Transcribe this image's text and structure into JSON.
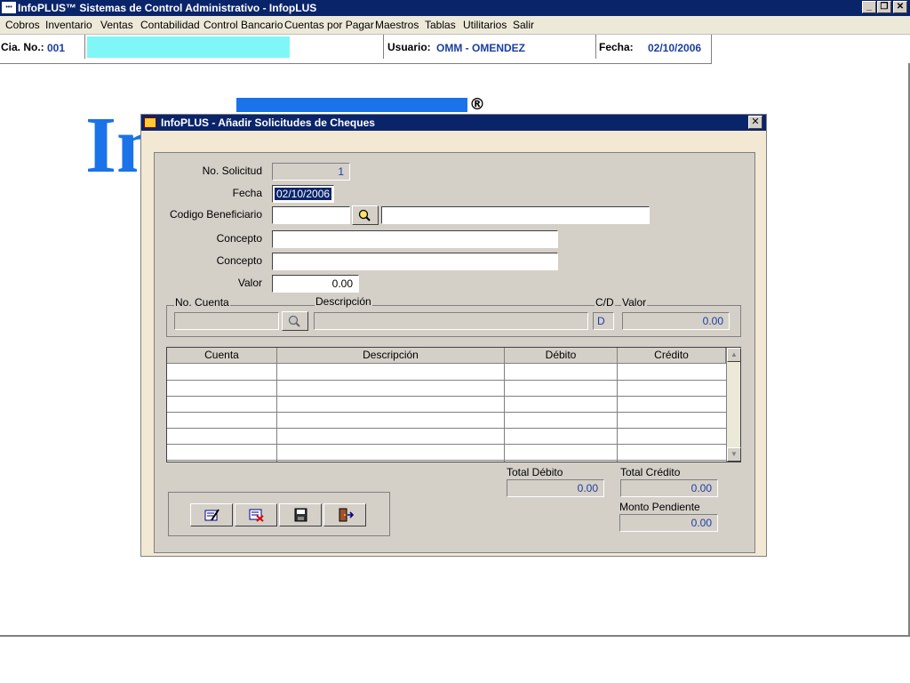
{
  "window": {
    "title": "InfoPLUS™ Sistemas de Control Administrativo - InfopLUS",
    "icon": "infoplus-app-icon"
  },
  "menu": [
    "Cobros",
    "Inventario",
    "Ventas",
    "Contabilidad",
    "Control Bancario",
    "Cuentas por Pagar",
    "Maestros",
    "Tablas",
    "Utilitarios",
    "Salir"
  ],
  "infobar": {
    "cia_label": "Cia. No.:",
    "cia_value": "001",
    "usuario_label": "Usuario:",
    "usuario_value": "OMM - OMENDEZ",
    "fecha_label": "Fecha:",
    "fecha_value": "02/10/2006"
  },
  "background": {
    "logo_text": "In",
    "registered": "®"
  },
  "dialog": {
    "title": "InfoPLUS - Añadir Solicitudes de Cheques",
    "no_solicitud_label": "No. Solicitud",
    "no_solicitud_value": "1",
    "fecha_label": "Fecha",
    "fecha_value": "02/10/2006",
    "codigo_label": "Codigo Beneficiario",
    "codigo_value": "",
    "beneficiario_nombre": "",
    "concepto1_label": "Concepto",
    "concepto1_value": "",
    "concepto2_label": "Concepto",
    "concepto2_value": "",
    "valor_label": "Valor",
    "valor_value": "0.00",
    "group": {
      "no_cuenta_label": "No. Cuenta",
      "descripcion_label": "Descripción",
      "cd_label": "C/D",
      "valor_label": "Valor",
      "no_cuenta_value": "",
      "descripcion_value": "",
      "cd_value": "D",
      "valor_value": "0.00"
    },
    "grid": {
      "columns": [
        "Cuenta",
        "Descripción",
        "Débito",
        "Crédito"
      ],
      "rows": 6
    },
    "totals": {
      "debito_label": "Total Débito",
      "debito_value": "0.00",
      "credito_label": "Total Crédito",
      "credito_value": "0.00",
      "pendiente_label": "Monto Pendiente",
      "pendiente_value": "0.00"
    },
    "toolbar": [
      "edit-form-icon",
      "delete-form-icon",
      "save-disk-icon",
      "exit-door-icon"
    ]
  },
  "colors": {
    "title_bar": "#0a246a",
    "accent_blue": "#1a73e8",
    "value_text": "#1c3ea0",
    "cyan": "#7ff7f7",
    "face": "#d4d0c8"
  }
}
